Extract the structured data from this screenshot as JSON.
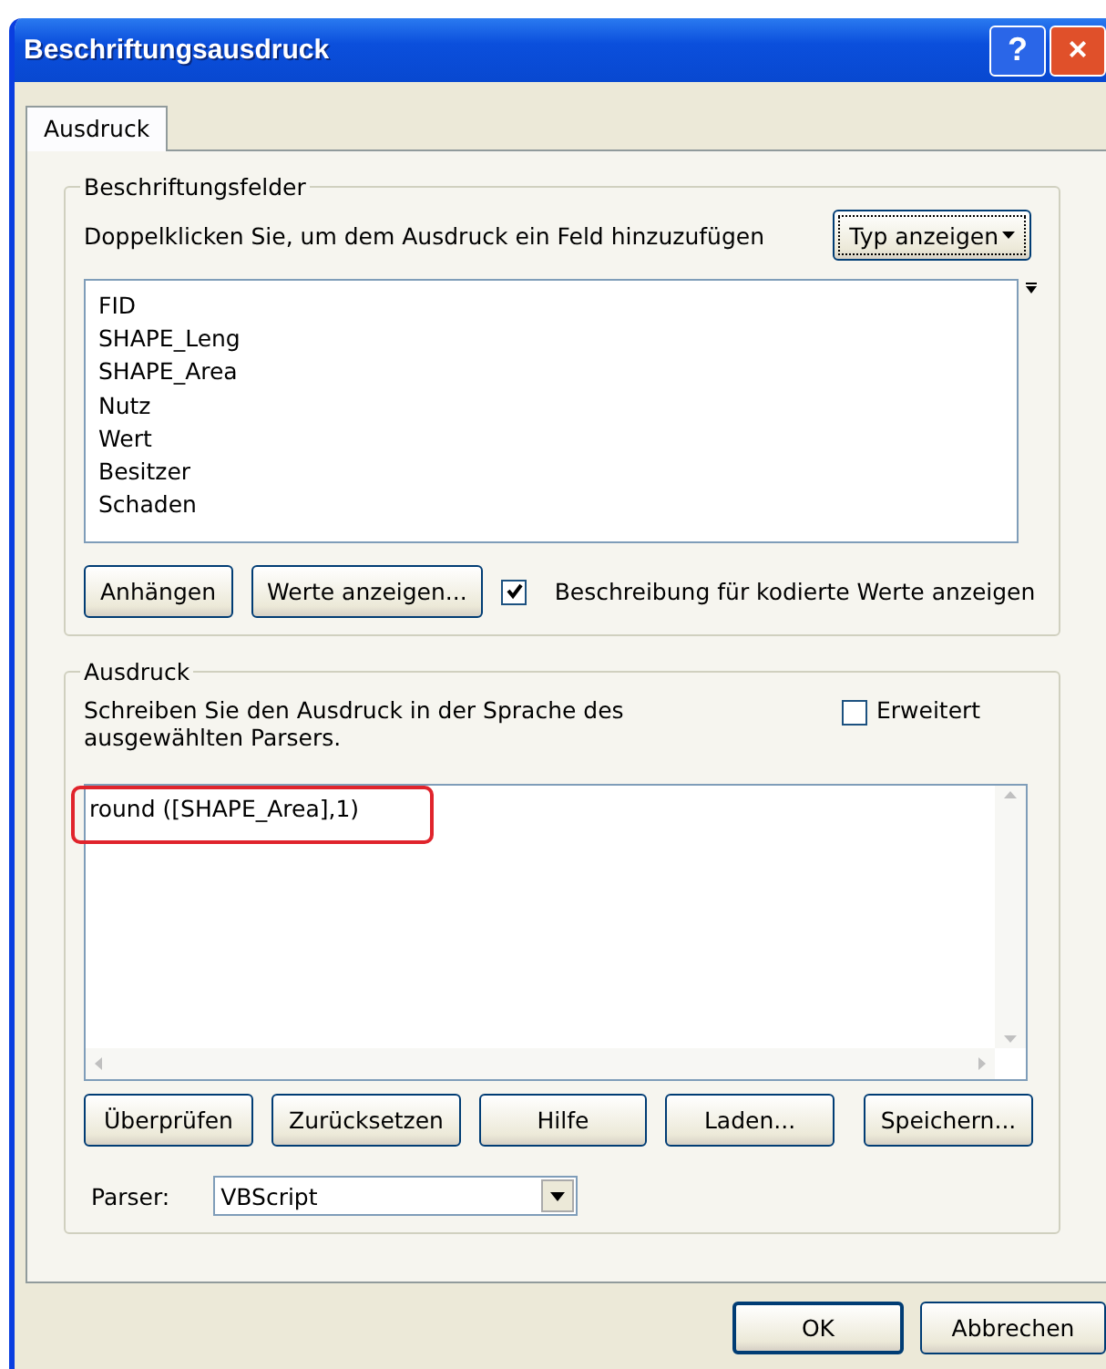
{
  "window": {
    "title": "Beschriftungsausdruck",
    "title_buttons": [
      "?",
      "×"
    ]
  },
  "tabs": [
    {
      "label": "Ausdruck",
      "selected": true
    }
  ],
  "fields_group": {
    "title": "Beschriftungsfelder",
    "hint": "Doppelklicken Sie, um dem Ausdruck ein Feld hinzuzufügen",
    "type_button": "Typ anzeigen",
    "fields": [
      {
        "name": "FID"
      },
      {
        "name": "SHAPE_Leng"
      },
      {
        "name": "SHAPE_Area"
      },
      {
        "name": "Nutz"
      },
      {
        "name": "Wert"
      },
      {
        "name": "Besitzer"
      },
      {
        "name": "Schaden"
      }
    ],
    "buttons": [
      "Anhängen",
      "Werte anzeigen..."
    ],
    "describe_checkbox": {
      "label": "Beschreibung für kodierte Werte anzeigen",
      "checked": true
    }
  },
  "expression_group": {
    "title": "Ausdruck",
    "description": "Schreiben Sie den Ausdruck in der Sprache des ausgewählten Parsers.",
    "advanced_checkbox": {
      "label": "Erweitert",
      "checked": false
    },
    "expression": "round ([SHAPE_Area],1)",
    "highlighted": true,
    "buttons": [
      "Überprüfen",
      "Zurücksetzen",
      "Hilfe",
      "Laden...",
      "Speichern..."
    ],
    "parser": {
      "label": "Parser:",
      "value": "VBScript"
    }
  },
  "dialog_buttons": [
    {
      "label": "OK",
      "default": true
    },
    {
      "label": "Abbrechen",
      "default": false
    }
  ]
}
